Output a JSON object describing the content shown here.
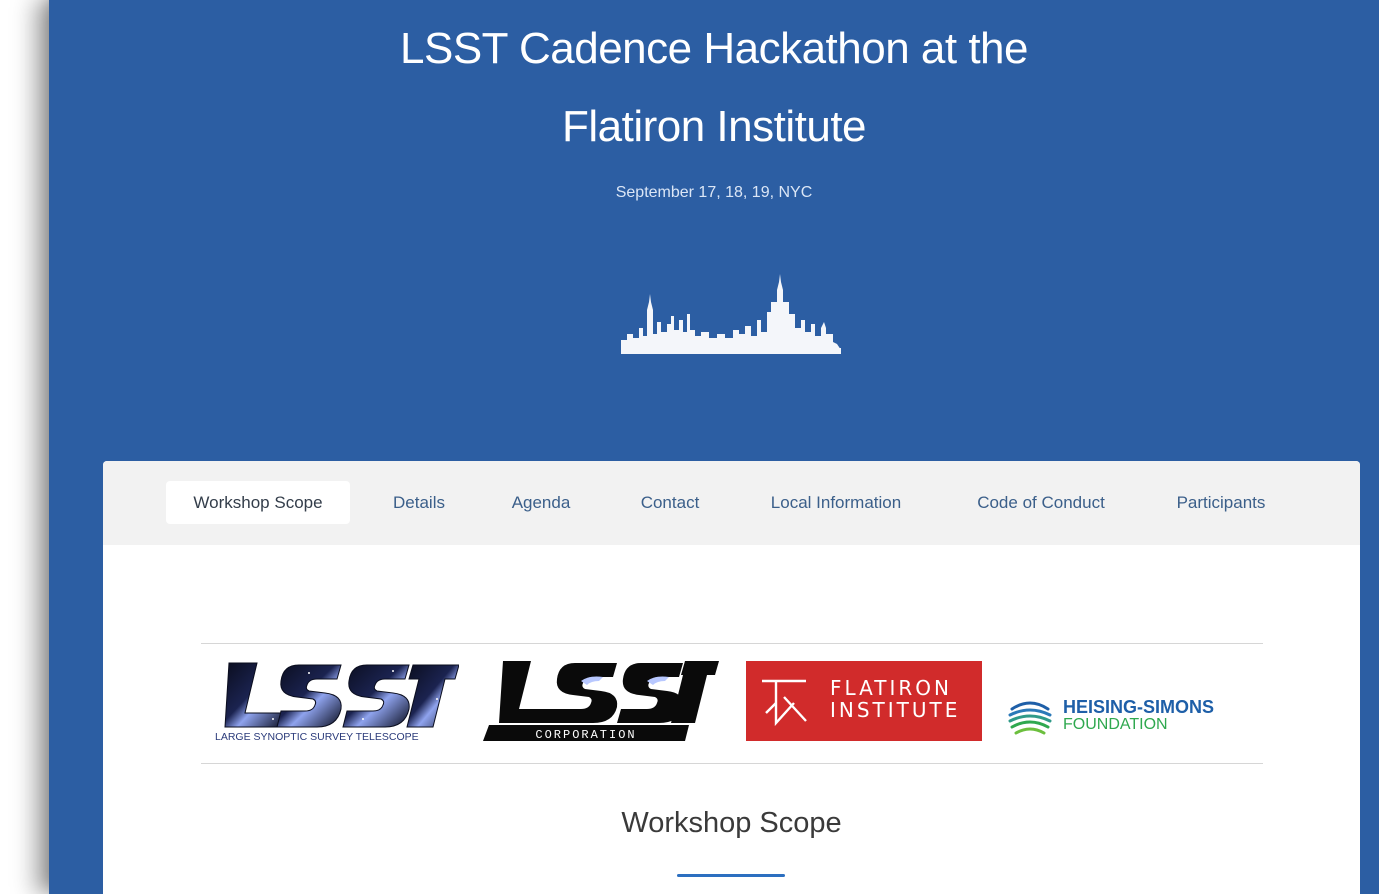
{
  "hero": {
    "title_line1": "LSST Cadence Hackathon at the",
    "title_line2": "Flatiron Institute",
    "subtitle": "September 17, 18, 19, NYC",
    "skyline_icon": "nyc-skyline-icon"
  },
  "nav": {
    "items": [
      {
        "label": "Workshop Scope",
        "active": true
      },
      {
        "label": "Details",
        "active": false
      },
      {
        "label": "Agenda",
        "active": false
      },
      {
        "label": "Contact",
        "active": false
      },
      {
        "label": "Local Information",
        "active": false
      },
      {
        "label": "Code of Conduct",
        "active": false
      },
      {
        "label": "Participants",
        "active": false
      }
    ]
  },
  "logos": {
    "lsst": {
      "wordmark": "LSST",
      "caption": "LARGE SYNOPTIC SURVEY TELESCOPE"
    },
    "lsst_corp": {
      "wordmark": "LSST",
      "caption": "CORPORATION"
    },
    "flatiron": {
      "line1": "FLATIRON",
      "line2": "INSTITUTE"
    },
    "heising": {
      "line1": "HEISING-SIMONS",
      "line2": "FOUNDATION"
    }
  },
  "section": {
    "title": "Workshop Scope"
  },
  "colors": {
    "hero_background": "#2c5ea3",
    "nav_background": "#f2f2f2",
    "nav_link": "#3b5f8a",
    "flatiron_red": "#d12b2b",
    "heising_blue": "#1e5fa8",
    "heising_green": "#2fa84f",
    "accent": "#2c6fc0"
  }
}
